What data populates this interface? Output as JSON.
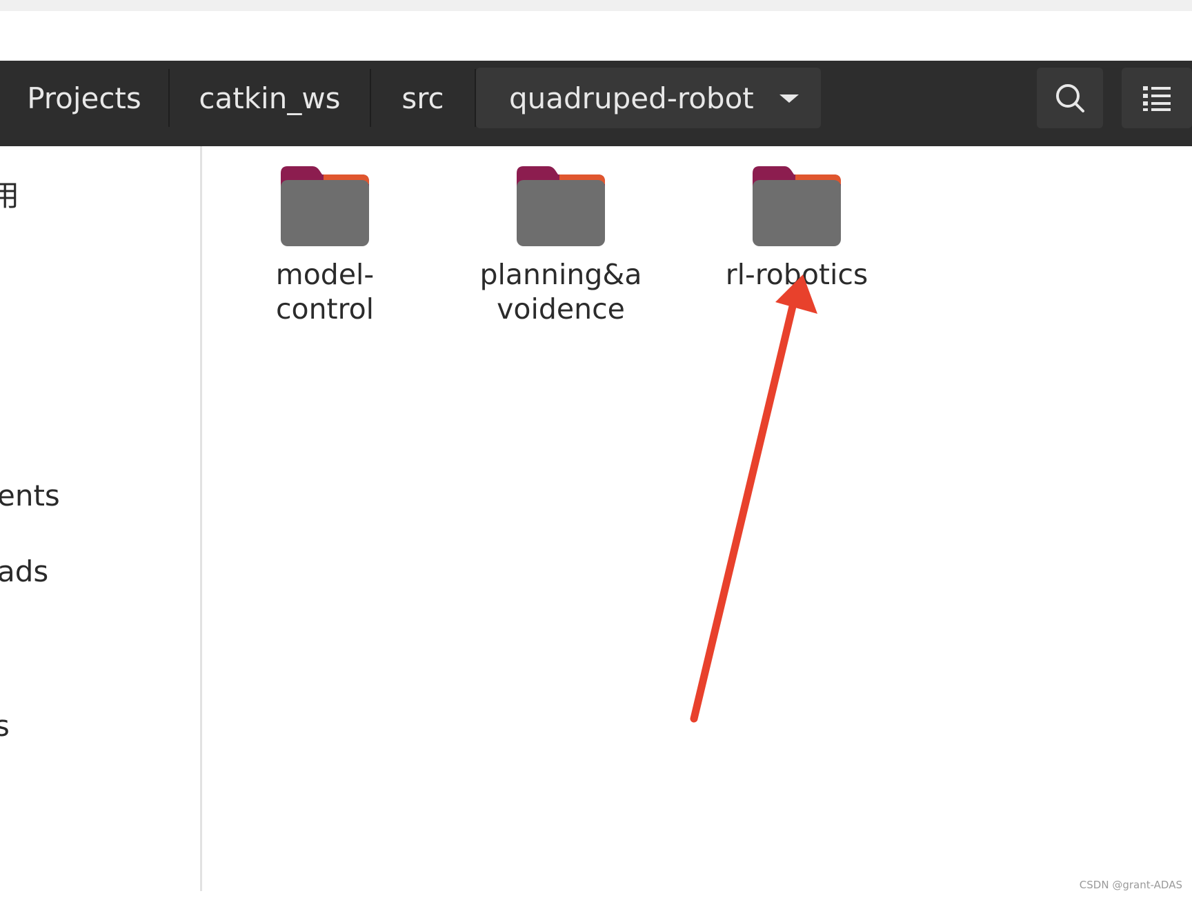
{
  "breadcrumb": {
    "items": [
      {
        "label": "Projects"
      },
      {
        "label": "catkin_ws"
      },
      {
        "label": "src"
      },
      {
        "label": "quadruped-robot"
      }
    ]
  },
  "toolbar": {
    "search_icon": "search-icon",
    "view_icon": "list-view-icon"
  },
  "sidebar": {
    "items": [
      {
        "label": "用"
      },
      {
        "label": "ents"
      },
      {
        "label": "ads"
      },
      {
        "label": "s"
      }
    ]
  },
  "files": [
    {
      "name": "model-\ncontrol",
      "icon": "folder-icon"
    },
    {
      "name": "planning&a\nvoidence",
      "icon": "folder-icon"
    },
    {
      "name": "rl-robotics",
      "icon": "folder-icon"
    }
  ],
  "watermark": "CSDN @grant-ADAS",
  "colors": {
    "headerbar": "#2d2d2d",
    "folder_body": "#6e6e6e",
    "folder_tab": "#8c1d4f",
    "folder_edge": "#e0562e",
    "annotation_arrow": "#e8412c"
  }
}
